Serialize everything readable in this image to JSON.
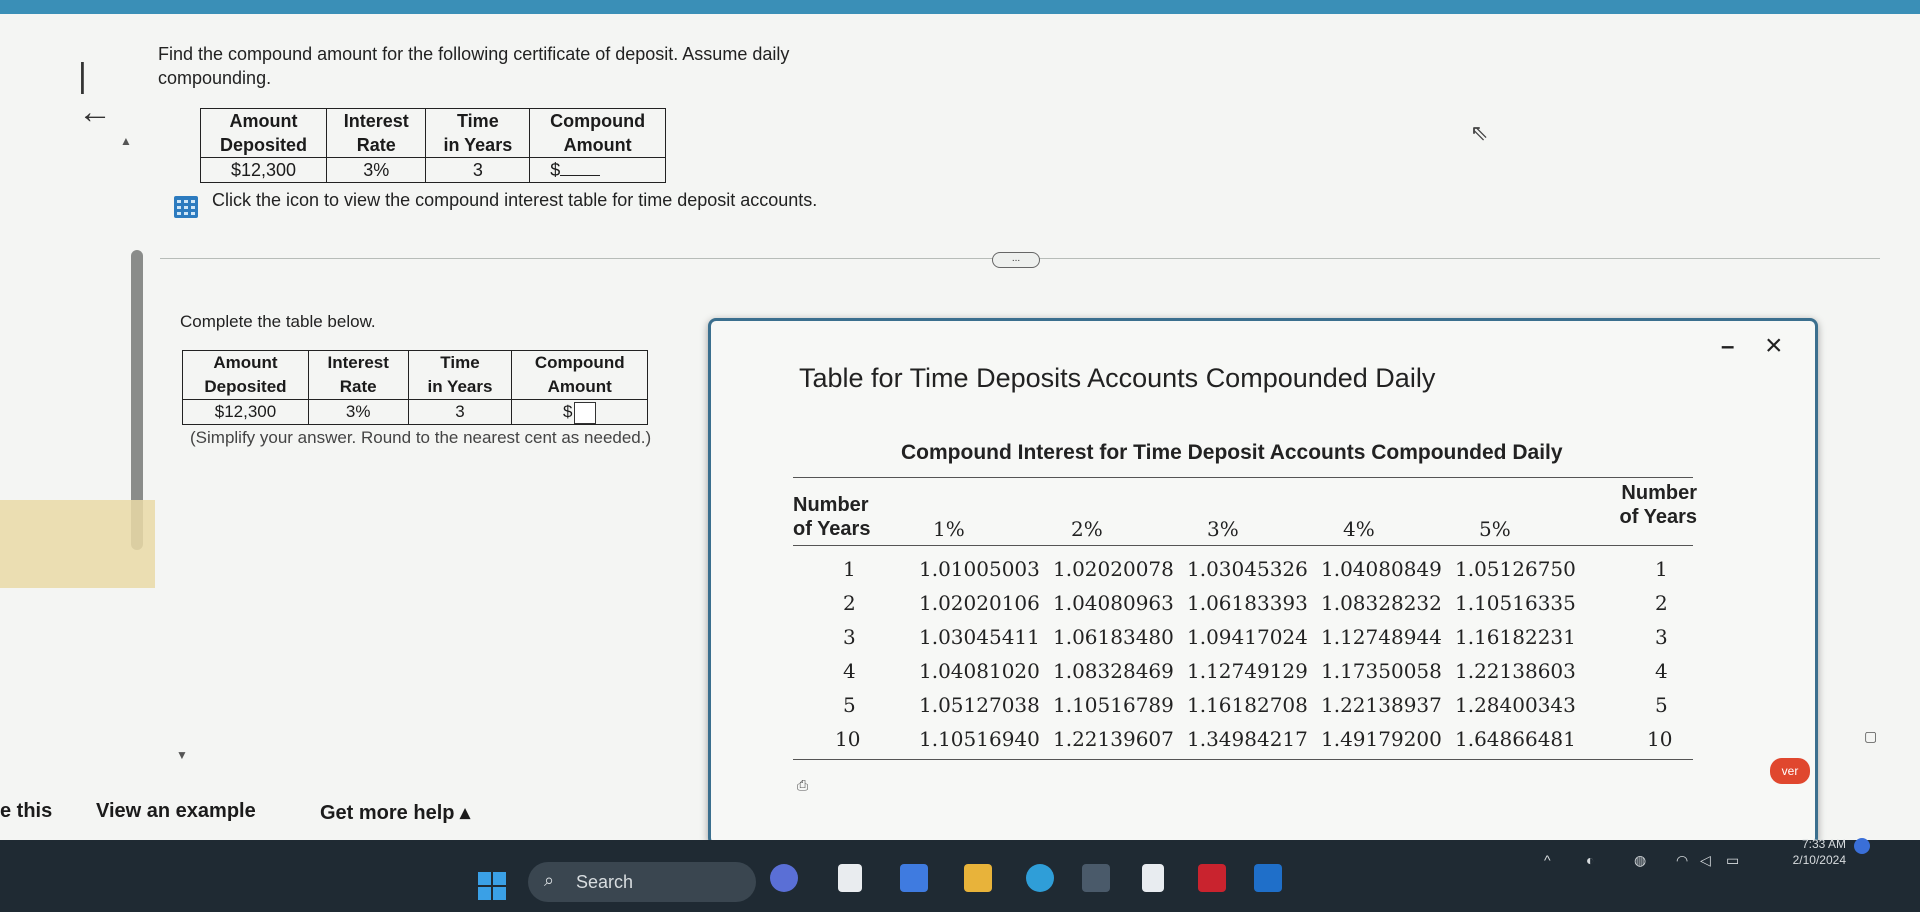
{
  "question": {
    "text": "Find the compound amount for the following certificate of deposit. Assume daily compounding.",
    "given_table": {
      "headers": [
        [
          "Amount",
          "Deposited"
        ],
        [
          "Interest",
          "Rate"
        ],
        [
          "Time",
          "in Years"
        ],
        [
          "Compound",
          "Amount"
        ]
      ],
      "row": [
        "$12,300",
        "3%",
        "3",
        "$"
      ]
    },
    "icon_hint": "Click the icon to view the compound interest table for time deposit accounts.",
    "more_label": "..."
  },
  "work_area": {
    "complete_label": "Complete the table below.",
    "answer_table": {
      "headers": [
        [
          "Amount",
          "Deposited"
        ],
        [
          "Interest",
          "Rate"
        ],
        [
          "Time",
          "in Years"
        ],
        [
          "Compound",
          "Amount"
        ]
      ],
      "row": [
        "$12,300",
        "3%",
        "3",
        "$"
      ]
    },
    "simplify_hint": "(Simplify your answer. Round to the nearest cent as needed.)"
  },
  "footer": {
    "left_partial": "e this",
    "view_example": "View an example",
    "get_help": "Get more help ▴"
  },
  "popup": {
    "title": "Table for Time Deposits Accounts Compounded Daily",
    "minimize": "–",
    "close": "×",
    "table": {
      "title": "Compound Interest for Time Deposit Accounts Compounded Daily",
      "left_header": [
        "Number",
        "of Years"
      ],
      "right_header": [
        "Number",
        "of Years"
      ],
      "rate_headers": [
        "1%",
        "2%",
        "3%",
        "4%",
        "5%"
      ],
      "rows": [
        {
          "years": "1",
          "values": [
            "1.01005003",
            "1.02020078",
            "1.03045326",
            "1.04080849",
            "1.05126750"
          ],
          "years_right": "1"
        },
        {
          "years": "2",
          "values": [
            "1.02020106",
            "1.04080963",
            "1.06183393",
            "1.08328232",
            "1.10516335"
          ],
          "years_right": "2"
        },
        {
          "years": "3",
          "values": [
            "1.03045411",
            "1.06183480",
            "1.09417024",
            "1.12748944",
            "1.16182231"
          ],
          "years_right": "3"
        },
        {
          "years": "4",
          "values": [
            "1.04081020",
            "1.08328469",
            "1.12749129",
            "1.17350058",
            "1.22138603"
          ],
          "years_right": "4"
        },
        {
          "years": "5",
          "values": [
            "1.05127038",
            "1.10516789",
            "1.16182708",
            "1.22138937",
            "1.28400343"
          ],
          "years_right": "5"
        },
        {
          "years": "10",
          "values": [
            "1.10516940",
            "1.22139607",
            "1.34984217",
            "1.49179200",
            "1.64866481"
          ],
          "years_right": "10"
        }
      ]
    }
  },
  "taskbar": {
    "search_placeholder": "Search",
    "clock_time": "7:33 AM",
    "clock_date": "2/10/2024"
  },
  "badge": {
    "label": "ver"
  },
  "colors": {
    "topbar": "#3a8fb7",
    "popup_border": "#3b6f8e",
    "taskbar": "#1f2a33",
    "icon_blue": "#2c7bbf"
  }
}
